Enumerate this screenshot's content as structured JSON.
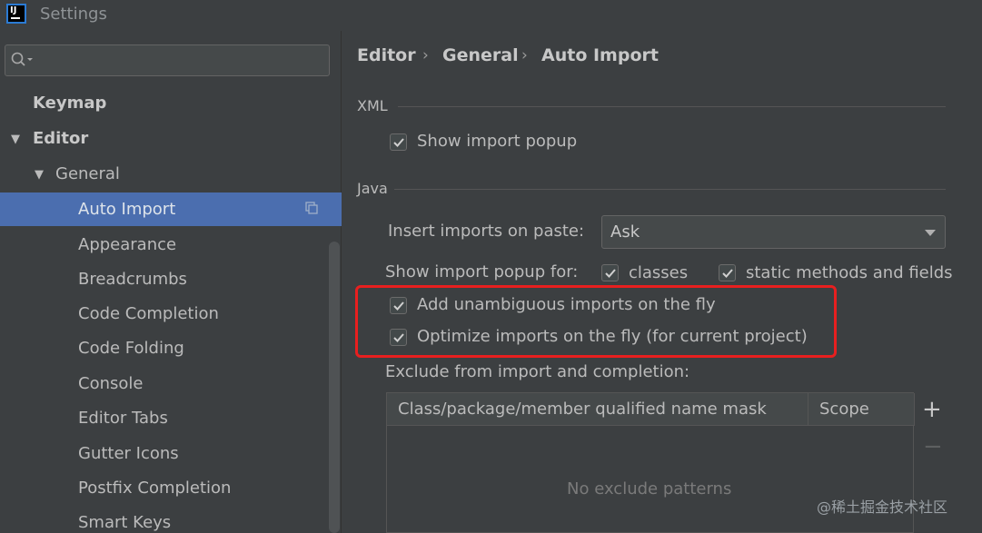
{
  "window": {
    "title": "Settings",
    "app_icon_text": "IJ"
  },
  "sidebar": {
    "search": {
      "placeholder": ""
    },
    "items": [
      {
        "label": "Keymap"
      },
      {
        "label": "Editor"
      },
      {
        "label": "General"
      },
      {
        "label": "Auto Import"
      },
      {
        "label": "Appearance"
      },
      {
        "label": "Breadcrumbs"
      },
      {
        "label": "Code Completion"
      },
      {
        "label": "Code Folding"
      },
      {
        "label": "Console"
      },
      {
        "label": "Editor Tabs"
      },
      {
        "label": "Gutter Icons"
      },
      {
        "label": "Postfix Completion"
      },
      {
        "label": "Smart Keys"
      }
    ],
    "selected": "Auto Import"
  },
  "breadcrumb": {
    "items": [
      "Editor",
      "General",
      "Auto Import"
    ],
    "separator": "›"
  },
  "xml": {
    "section_label": "XML",
    "show_import_popup": {
      "label": "Show import popup",
      "checked": true
    }
  },
  "java": {
    "section_label": "Java",
    "insert_on_paste": {
      "label": "Insert imports on paste:",
      "value": "Ask"
    },
    "show_popup_for": {
      "label": "Show import popup for:",
      "classes": {
        "label": "classes",
        "checked": true
      },
      "static": {
        "label": "static methods and fields",
        "checked": true
      }
    },
    "add_unambiguous": {
      "label": "Add unambiguous imports on the fly",
      "checked": true
    },
    "optimize_imports": {
      "label": "Optimize imports on the fly (for current project)",
      "checked": true
    },
    "exclude": {
      "label": "Exclude from import and completion:",
      "columns": [
        "Class/package/member qualified name mask",
        "Scope"
      ],
      "empty_text": "No exclude patterns",
      "add_label": "+",
      "remove_label": "−"
    }
  },
  "watermark": "@稀土掘金技术社区",
  "colors": {
    "selection": "#4b6eaf",
    "highlight_box": "#e81f1f",
    "background": "#3c3f41"
  }
}
